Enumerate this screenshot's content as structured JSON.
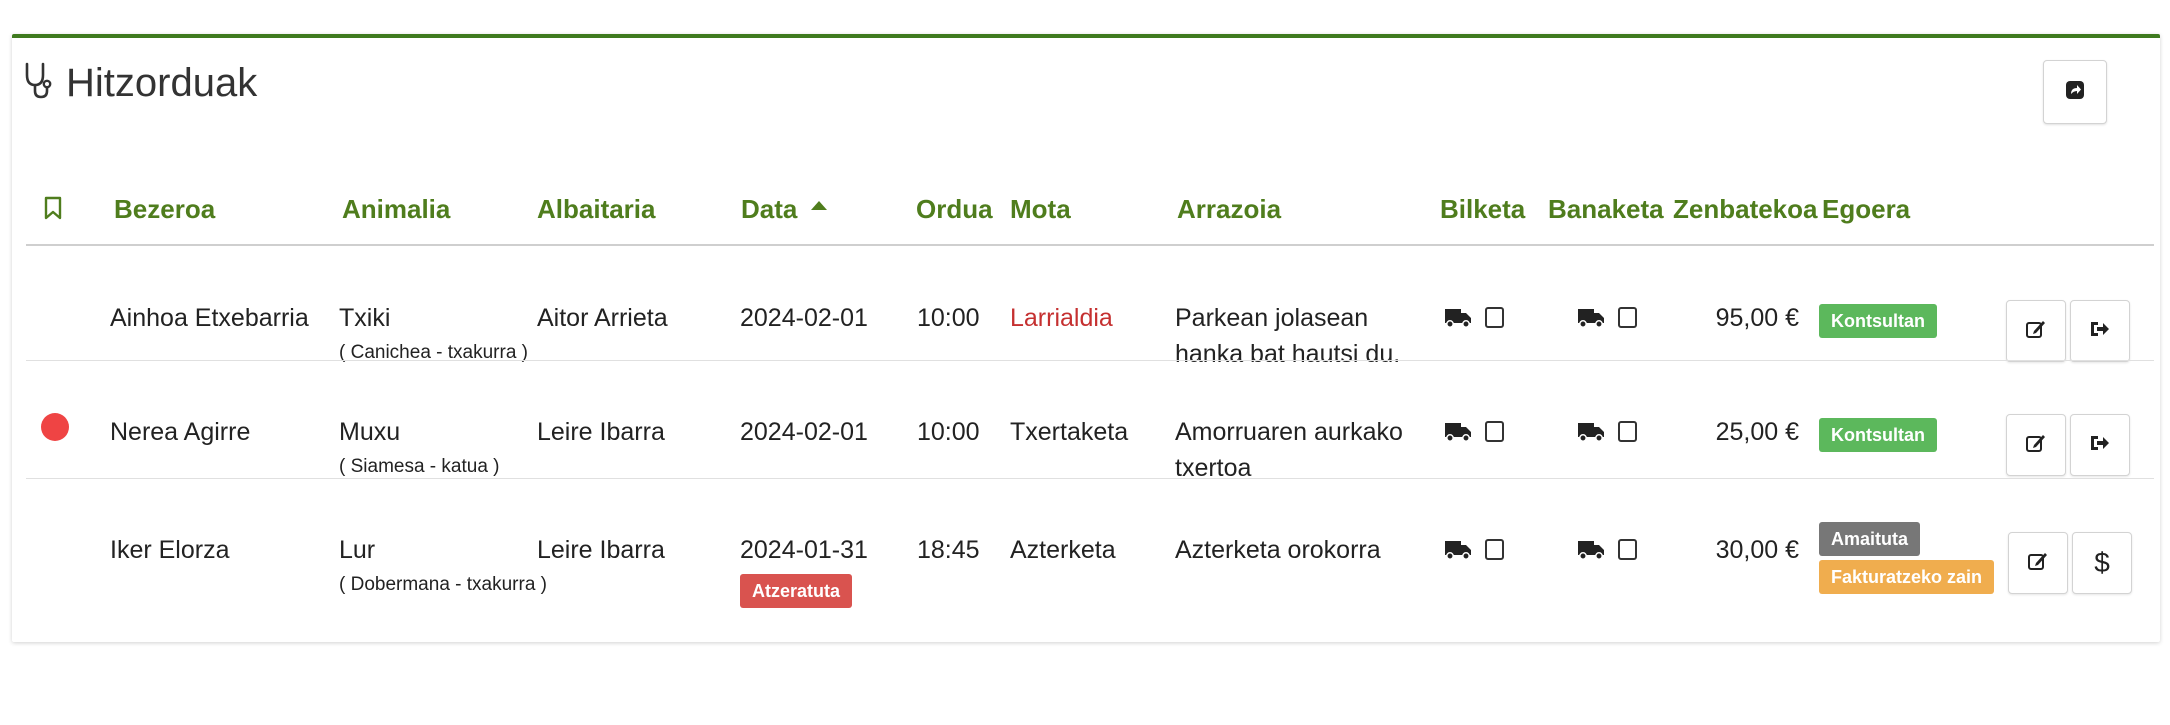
{
  "panel": {
    "title": "Hitzorduak",
    "accent_color": "#3f7a1f",
    "title_icon": "stethoscope-icon",
    "refresh_icon": "share-square-icon"
  },
  "table": {
    "columns": {
      "bookmark_icon": "bookmark-icon",
      "client": "Bezeroa",
      "animal": "Animalia",
      "vet": "Albaitaria",
      "date": "Data",
      "date_sort_icon": "sort-up-icon",
      "time": "Ordua",
      "type": "Mota",
      "reason": "Arrazoia",
      "pickup": "Bilketa",
      "delivery": "Banaketa",
      "amount": "Zenbatekoa",
      "status": "Egoera"
    },
    "colors": {
      "header_text": "#4f7d1d",
      "badge_green": "#5cb85c",
      "badge_gray": "#777777",
      "badge_red": "#d9534f",
      "badge_orange": "#f0ad4e",
      "urgent_text": "#c53030",
      "dot_red": "#ef4444"
    },
    "rows": [
      {
        "client": "Ainhoa Etxebarria",
        "animal": "Txiki",
        "animal_detail": "( Canichea - txakurra )",
        "vet": "Aitor Arrieta",
        "date": "2024-02-01",
        "time": "10:00",
        "type": "Larrialdia",
        "reason": "Parkean jolasean hanka bat hautsi du.",
        "amount": "95,00 €",
        "statuses": [
          "Kontsultan"
        ],
        "actions": [
          "edit-icon",
          "sign-out-icon"
        ]
      },
      {
        "client": "Nerea Agirre",
        "animal": "Muxu",
        "animal_detail": "( Siamesa - katua )",
        "vet": "Leire Ibarra",
        "date": "2024-02-01",
        "time": "10:00",
        "type": "Txertaketa",
        "reason": "Amorruaren aurkako txertoa",
        "amount": "25,00 €",
        "statuses": [
          "Kontsultan"
        ],
        "actions": [
          "edit-icon",
          "sign-out-icon"
        ]
      },
      {
        "client": "Iker Elorza",
        "animal": "Lur",
        "animal_detail": "( Dobermana - txakurra )",
        "vet": "Leire Ibarra",
        "date": "2024-01-31",
        "date_badge": "Atzeratuta",
        "time": "18:45",
        "type": "Azterketa",
        "reason": "Azterketa orokorra",
        "amount": "30,00 €",
        "statuses": [
          "Amaituta",
          "Fakturatzeko zain"
        ],
        "actions": [
          "edit-icon"
        ],
        "charge_label": "$"
      }
    ]
  }
}
